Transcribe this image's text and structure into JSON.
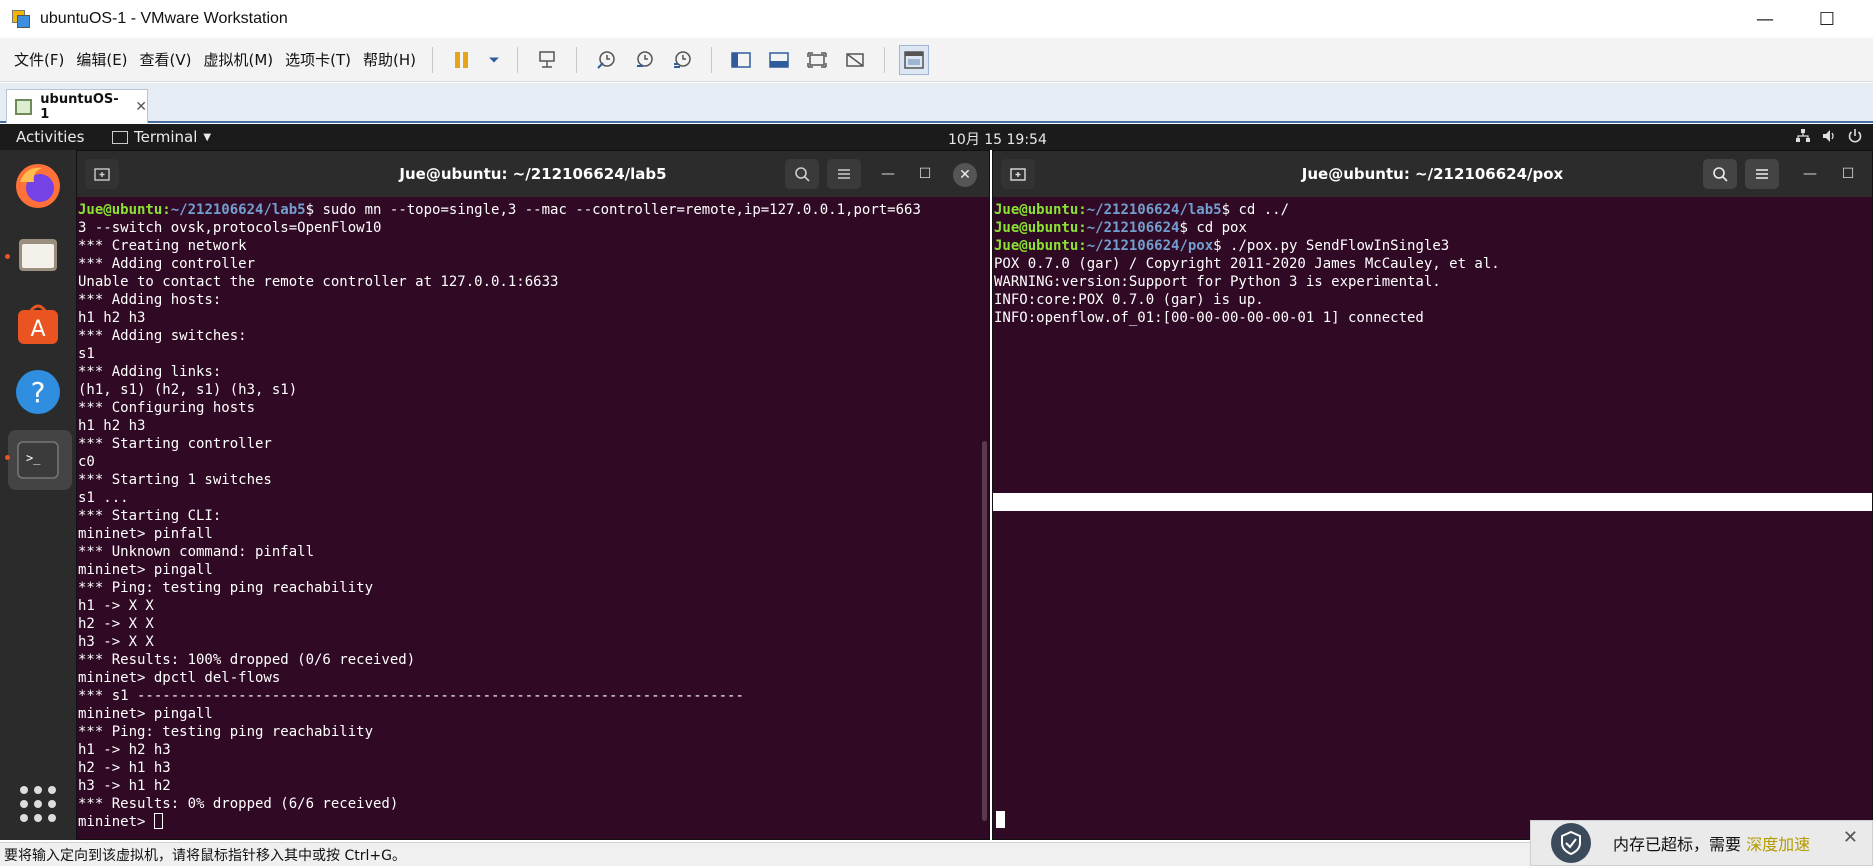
{
  "window": {
    "title": "ubuntuOS-1 - VMware Workstation",
    "minimize_glyph": "—",
    "maximize_glyph": "☐"
  },
  "menubar": {
    "items": [
      "文件(F)",
      "编辑(E)",
      "查看(V)",
      "虚拟机(M)",
      "选项卡(T)",
      "帮助(H)"
    ]
  },
  "tabs": [
    {
      "label": "ubuntuOS-1",
      "close": "✕"
    }
  ],
  "ubuntu_topbar": {
    "activities": "Activities",
    "app_menu": "Terminal",
    "clock": "10月 15  19:54"
  },
  "terminal_left": {
    "title": "Jue@ubuntu: ~/212106624/lab5",
    "lines": [
      {
        "user": "Jue@ubuntu",
        "path": "~/212106624/lab5",
        "cmd": " sudo mn --topo=single,3 --mac --controller=remote,ip=127.0.0.1,port=663"
      },
      {
        "text": "3 --switch ovsk,protocols=OpenFlow10"
      },
      {
        "text": "*** Creating network"
      },
      {
        "text": "*** Adding controller"
      },
      {
        "text": "Unable to contact the remote controller at 127.0.0.1:6633"
      },
      {
        "text": "*** Adding hosts:"
      },
      {
        "text": "h1 h2 h3"
      },
      {
        "text": "*** Adding switches:"
      },
      {
        "text": "s1"
      },
      {
        "text": "*** Adding links:"
      },
      {
        "text": "(h1, s1) (h2, s1) (h3, s1)"
      },
      {
        "text": "*** Configuring hosts"
      },
      {
        "text": "h1 h2 h3"
      },
      {
        "text": "*** Starting controller"
      },
      {
        "text": "c0"
      },
      {
        "text": "*** Starting 1 switches"
      },
      {
        "text": "s1 ..."
      },
      {
        "text": "*** Starting CLI:"
      },
      {
        "text": "mininet> pinfall"
      },
      {
        "text": "*** Unknown command: pinfall"
      },
      {
        "text": "mininet> pingall"
      },
      {
        "text": "*** Ping: testing ping reachability"
      },
      {
        "text": "h1 -> X X"
      },
      {
        "text": "h2 -> X X"
      },
      {
        "text": "h3 -> X X"
      },
      {
        "text": "*** Results: 100% dropped (0/6 received)"
      },
      {
        "text": "mininet> dpctl del-flows"
      },
      {
        "text": "*** s1 ------------------------------------------------------------------------"
      },
      {
        "text": "mininet> pingall"
      },
      {
        "text": "*** Ping: testing ping reachability"
      },
      {
        "text": "h1 -> h2 h3"
      },
      {
        "text": "h2 -> h1 h3"
      },
      {
        "text": "h3 -> h1 h2"
      },
      {
        "text": "*** Results: 0% dropped (6/6 received)"
      },
      {
        "text": "mininet> ",
        "cursor": true
      }
    ]
  },
  "terminal_right": {
    "title": "Jue@ubuntu: ~/212106624/pox",
    "lines": [
      {
        "user": "Jue@ubuntu",
        "path": "~/212106624/lab5",
        "cmd": " cd ../"
      },
      {
        "user": "Jue@ubuntu",
        "path": "~/212106624",
        "cmd": " cd pox"
      },
      {
        "user": "Jue@ubuntu",
        "path": "~/212106624/pox",
        "cmd": " ./pox.py SendFlowInSingle3"
      },
      {
        "text": "POX 0.7.0 (gar) / Copyright 2011-2020 James McCauley, et al."
      },
      {
        "text": "WARNING:version:Support for Python 3 is experimental."
      },
      {
        "text": "INFO:core:POX 0.7.0 (gar) is up."
      },
      {
        "text": "INFO:openflow.of_01:[00-00-00-00-00-01 1] connected"
      }
    ]
  },
  "statusbar": {
    "text": "要将输入定向到该虚拟机，请将鼠标指针移入其中或按 Ctrl+G。"
  },
  "toast": {
    "text": "内存已超标，需要 ",
    "link": "深度加速",
    "close": "✕"
  },
  "colors": {
    "terminal_bg": "#300a24",
    "prompt_user": "#8ae234",
    "prompt_path": "#729fcf",
    "ubuntu_orange": "#e95420"
  }
}
